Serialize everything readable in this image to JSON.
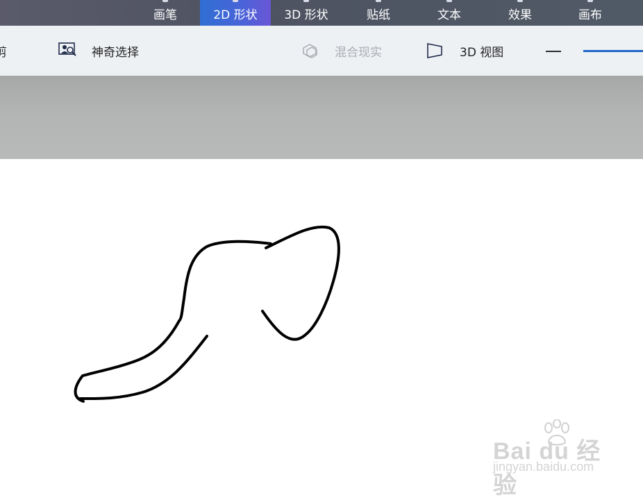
{
  "ribbon_tabs": [
    {
      "label": "画笔",
      "active": false
    },
    {
      "label": "2D 形状",
      "active": true
    },
    {
      "label": "3D 形状",
      "active": false
    },
    {
      "label": "贴纸",
      "active": false
    },
    {
      "label": "文本",
      "active": false
    },
    {
      "label": "效果",
      "active": false
    },
    {
      "label": "画布",
      "active": false
    }
  ],
  "toolbar": {
    "crop_label": "裁剪",
    "magic_select_label": "神奇选择",
    "mixed_reality_label": "混合现实",
    "view_3d_label": "3D 视图"
  },
  "watermark": {
    "main": "Bai du 经验",
    "sub": "jingyan.baidu.com"
  },
  "colors": {
    "active_tab": "#2f6fd3",
    "topbar": "#505a66",
    "toolbar": "#eef1f4",
    "zoom_accent": "#1f66c7",
    "stroke": "#000000"
  }
}
